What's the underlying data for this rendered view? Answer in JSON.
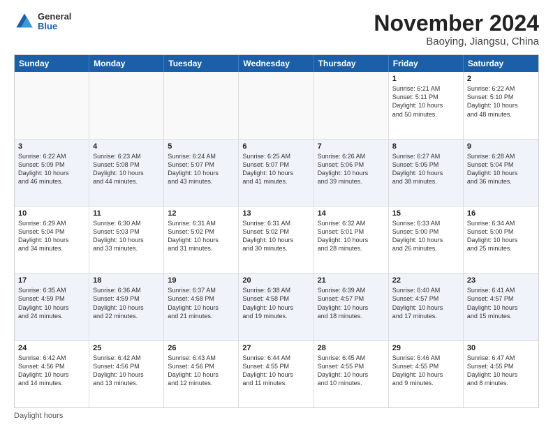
{
  "logo": {
    "general": "General",
    "blue": "Blue"
  },
  "title": "November 2024",
  "location": "Baoying, Jiangsu, China",
  "days_of_week": [
    "Sunday",
    "Monday",
    "Tuesday",
    "Wednesday",
    "Thursday",
    "Friday",
    "Saturday"
  ],
  "footer": "Daylight hours",
  "weeks": [
    [
      {
        "day": "",
        "info": "",
        "empty": true
      },
      {
        "day": "",
        "info": "",
        "empty": true
      },
      {
        "day": "",
        "info": "",
        "empty": true
      },
      {
        "day": "",
        "info": "",
        "empty": true
      },
      {
        "day": "",
        "info": "",
        "empty": true
      },
      {
        "day": "1",
        "info": "Sunrise: 6:21 AM\nSunset: 5:11 PM\nDaylight: 10 hours\nand 50 minutes."
      },
      {
        "day": "2",
        "info": "Sunrise: 6:22 AM\nSunset: 5:10 PM\nDaylight: 10 hours\nand 48 minutes."
      }
    ],
    [
      {
        "day": "3",
        "info": "Sunrise: 6:22 AM\nSunset: 5:09 PM\nDaylight: 10 hours\nand 46 minutes."
      },
      {
        "day": "4",
        "info": "Sunrise: 6:23 AM\nSunset: 5:08 PM\nDaylight: 10 hours\nand 44 minutes."
      },
      {
        "day": "5",
        "info": "Sunrise: 6:24 AM\nSunset: 5:07 PM\nDaylight: 10 hours\nand 43 minutes."
      },
      {
        "day": "6",
        "info": "Sunrise: 6:25 AM\nSunset: 5:07 PM\nDaylight: 10 hours\nand 41 minutes."
      },
      {
        "day": "7",
        "info": "Sunrise: 6:26 AM\nSunset: 5:06 PM\nDaylight: 10 hours\nand 39 minutes."
      },
      {
        "day": "8",
        "info": "Sunrise: 6:27 AM\nSunset: 5:05 PM\nDaylight: 10 hours\nand 38 minutes."
      },
      {
        "day": "9",
        "info": "Sunrise: 6:28 AM\nSunset: 5:04 PM\nDaylight: 10 hours\nand 36 minutes."
      }
    ],
    [
      {
        "day": "10",
        "info": "Sunrise: 6:29 AM\nSunset: 5:04 PM\nDaylight: 10 hours\nand 34 minutes."
      },
      {
        "day": "11",
        "info": "Sunrise: 6:30 AM\nSunset: 5:03 PM\nDaylight: 10 hours\nand 33 minutes."
      },
      {
        "day": "12",
        "info": "Sunrise: 6:31 AM\nSunset: 5:02 PM\nDaylight: 10 hours\nand 31 minutes."
      },
      {
        "day": "13",
        "info": "Sunrise: 6:31 AM\nSunset: 5:02 PM\nDaylight: 10 hours\nand 30 minutes."
      },
      {
        "day": "14",
        "info": "Sunrise: 6:32 AM\nSunset: 5:01 PM\nDaylight: 10 hours\nand 28 minutes."
      },
      {
        "day": "15",
        "info": "Sunrise: 6:33 AM\nSunset: 5:00 PM\nDaylight: 10 hours\nand 26 minutes."
      },
      {
        "day": "16",
        "info": "Sunrise: 6:34 AM\nSunset: 5:00 PM\nDaylight: 10 hours\nand 25 minutes."
      }
    ],
    [
      {
        "day": "17",
        "info": "Sunrise: 6:35 AM\nSunset: 4:59 PM\nDaylight: 10 hours\nand 24 minutes."
      },
      {
        "day": "18",
        "info": "Sunrise: 6:36 AM\nSunset: 4:59 PM\nDaylight: 10 hours\nand 22 minutes."
      },
      {
        "day": "19",
        "info": "Sunrise: 6:37 AM\nSunset: 4:58 PM\nDaylight: 10 hours\nand 21 minutes."
      },
      {
        "day": "20",
        "info": "Sunrise: 6:38 AM\nSunset: 4:58 PM\nDaylight: 10 hours\nand 19 minutes."
      },
      {
        "day": "21",
        "info": "Sunrise: 6:39 AM\nSunset: 4:57 PM\nDaylight: 10 hours\nand 18 minutes."
      },
      {
        "day": "22",
        "info": "Sunrise: 6:40 AM\nSunset: 4:57 PM\nDaylight: 10 hours\nand 17 minutes."
      },
      {
        "day": "23",
        "info": "Sunrise: 6:41 AM\nSunset: 4:57 PM\nDaylight: 10 hours\nand 15 minutes."
      }
    ],
    [
      {
        "day": "24",
        "info": "Sunrise: 6:42 AM\nSunset: 4:56 PM\nDaylight: 10 hours\nand 14 minutes."
      },
      {
        "day": "25",
        "info": "Sunrise: 6:42 AM\nSunset: 4:56 PM\nDaylight: 10 hours\nand 13 minutes."
      },
      {
        "day": "26",
        "info": "Sunrise: 6:43 AM\nSunset: 4:56 PM\nDaylight: 10 hours\nand 12 minutes."
      },
      {
        "day": "27",
        "info": "Sunrise: 6:44 AM\nSunset: 4:55 PM\nDaylight: 10 hours\nand 11 minutes."
      },
      {
        "day": "28",
        "info": "Sunrise: 6:45 AM\nSunset: 4:55 PM\nDaylight: 10 hours\nand 10 minutes."
      },
      {
        "day": "29",
        "info": "Sunrise: 6:46 AM\nSunset: 4:55 PM\nDaylight: 10 hours\nand 9 minutes."
      },
      {
        "day": "30",
        "info": "Sunrise: 6:47 AM\nSunset: 4:55 PM\nDaylight: 10 hours\nand 8 minutes."
      }
    ]
  ]
}
